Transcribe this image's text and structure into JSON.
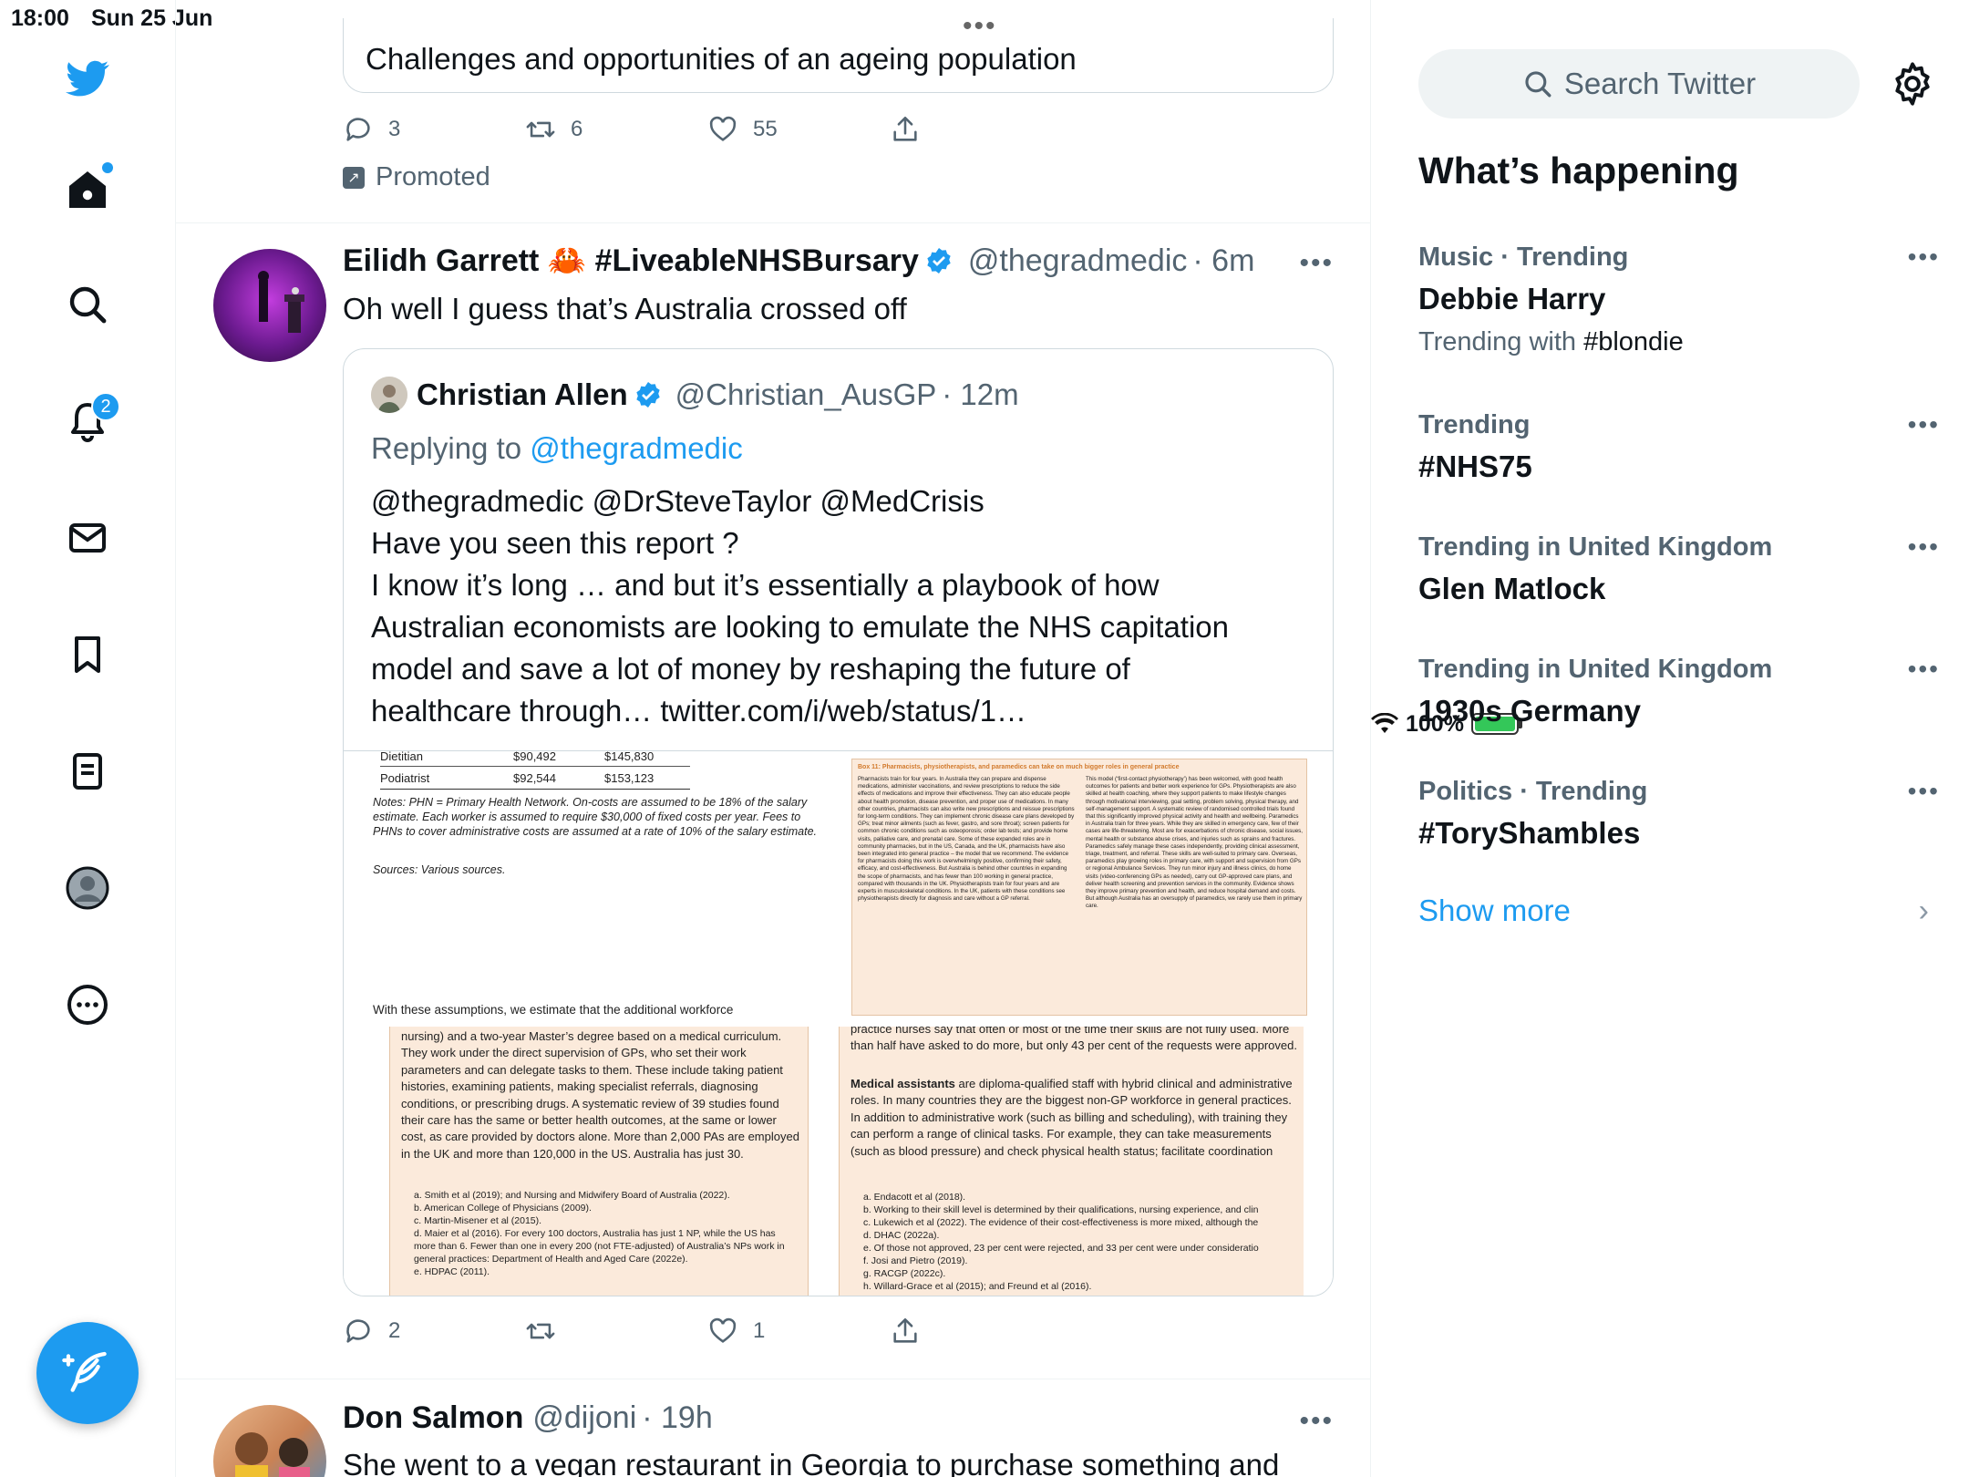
{
  "status_bar": {
    "time": "18:00",
    "date": "Sun 25 Jun",
    "battery": "100%",
    "battery_level": 1.0
  },
  "nav": {
    "notifications_badge": "2",
    "icons": [
      "twitter-logo-icon",
      "home-icon",
      "search-icon",
      "bell-icon",
      "mail-icon",
      "bookmark-icon",
      "lists-icon",
      "profile-icon",
      "more-circle-icon",
      "compose-icon"
    ]
  },
  "promo_tweet": {
    "card_text": "Challenges and opportunities of an ageing population",
    "replies": "3",
    "retweets": "6",
    "likes": "55",
    "promoted_label": "Promoted"
  },
  "tweet1": {
    "author_name": "Eilidh Garrett 🦀 #LiveableNHSBursary",
    "handle": "@thegradmedic",
    "time": "· 6m",
    "text": "Oh well I guess that’s Australia crossed off",
    "replies": "2",
    "retweets": "",
    "likes": "1",
    "quote": {
      "author_name": "Christian Allen",
      "handle": "@Christian_AusGP",
      "time": "· 12m",
      "replying_prefix": "Replying to",
      "replying_to": "@thegradmedic",
      "lines": [
        "@thegradmedic @DrSteveTaylor @MedCrisis",
        "Have you seen this report ?",
        "I know it’s long … and but it’s essentially a playbook of how",
        "Australian economists are looking to emulate the NHS capitation",
        "model and save a lot of money by reshaping the future of",
        "healthcare through… twitter.com/i/web/status/1…"
      ],
      "images": {
        "a": {
          "rows": [
            [
              "Dietitian",
              "$90,492",
              "$145,830"
            ],
            [
              "Podiatrist",
              "$92,544",
              "$153,123"
            ]
          ],
          "notes": "Notes: PHN = Primary Health Network. On-costs are assumed to be 18% of the salary estimate. Each worker is assumed to require $30,000 of fixed costs per year. Fees to PHNs to cover administrative costs are assumed at a rate of 10% of the salary estimate.",
          "sources": "Sources: Various sources.",
          "footer": "With these assumptions, we estimate that the additional workforce"
        },
        "b": {
          "title": "Box 11: Pharmacists, physiotherapists, and paramedics can take on much bigger roles in general practice",
          "col1": "Pharmacists train for four years. In Australia they can prepare and dispense medications, administer vaccinations, and review prescriptions to reduce the side effects of medications and improve their effectiveness. They can also educate people about health promotion, disease prevention, and proper use of medications. In many other countries, pharmacists can also write new prescriptions and reissue prescriptions for long-term conditions. They can implement chronic disease care plans developed by GPs; treat minor ailments (such as fever, gastro, and sore throat); screen patients for common chronic conditions such as osteoporosis; order lab tests; and provide home visits, palliative care, and prenatal care. Some of these expanded roles are in community pharmacies, but in the US, Canada, and the UK, pharmacists have also been integrated into general practice – the model that we recommend. The evidence for pharmacists doing this work is overwhelmingly positive, confirming their safety, efficacy, and cost-effectiveness. But Australia is behind other countries in expanding the scope of pharmacists, and has fewer than 100 working in general practice, compared with thousands in the UK. Physiotherapists train for four years and are experts in musculoskeletal conditions. In the UK, patients with these conditions see physiotherapists directly for diagnosis and care without a GP referral.",
          "col2": "This model (‘first-contact physiotherapy’) has been welcomed, with good health outcomes for patients and better work experience for GPs. Physiotherapists are also skilled at health coaching, where they support patients to make lifestyle changes through motivational interviewing, goal setting, problem solving, physical therapy, and self-management support. A systematic review of randomised controlled trials found that this significantly improved physical activity and health and wellbeing. Paramedics in Australia train for three years. While they are skilled in emergency care, few of their cases are life-threatening. Most are for exacerbations of chronic disease, social issues, mental health or substance abuse crises, and injuries such as sprains and fractures. Paramedics safely manage these cases independently, providing clinical assessment, triage, treatment, and referral. These skills are well-suited to primary care. Overseas, paramedics play growing roles in primary care, with support and supervision from GPs or regional Ambulance Services. They run minor injury and illness clinics, do home visits (video-conferencing GPs as needed), carry out GP-approved care plans, and deliver health screening and prevention services in the community. Evidence shows they improve primary prevention and health, and reduce hospital demand and costs. But although Australia has an oversupply of paramedics, we rarely use them in primary care."
        },
        "c": {
          "text": "nursing) and a two-year Master’s degree based on a medical curriculum. They work under the direct supervision of GPs, who set their work parameters and can delegate tasks to them. These include taking patient histories, examining patients, making specialist referrals, diagnosing conditions, or prescribing drugs. A systematic review of 39 studies found their care has the same or better health outcomes, at the same or lower cost, as care provided by doctors alone. More than 2,000 PAs are employed in the UK and more than 120,000 in the US. Australia has just 30.",
          "refs": [
            "a.  Smith et al (2019);  and Nursing and Midwifery Board of Australia (2022).",
            "b.  American College of Physicians (2009).",
            "c.  Martin-Misener et al (2015).",
            "d.  Maier et al (2016). For every 100 doctors, Australia has just 1 NP, while the US has more than 6. Fewer than one in every 200 (not FTE-adjusted) of Australia’s NPs work in general practices: Department of Health and Aged Care (2022e).",
            "e.  HDPAC (2011)."
          ]
        },
        "d": {
          "text_top": "practice nurses say that often or most of the time their skills are not fully used. More than half have asked to do more, but only 43 per cent of the requests were approved.",
          "bold": "Medical assistants",
          "text_main": " are diploma-qualified staff with hybrid clinical and administrative roles. In many countries they are the biggest non-GP workforce in general practices. In addition to administrative work (such as billing and scheduling), with training they can perform a range of clinical tasks. For example, they can take measurements (such as blood pressure) and check physical health status; facilitate coordination",
          "refs": [
            "a.  Endacott et al (2018).",
            "b.  Working to their skill level is determined by their qualifications, nursing experience, and clin",
            "c.  Lukewich et al (2022). The evidence of their cost-effectiveness is more mixed, although the",
            "d.  DHAC (2022a).",
            "e.  Of those not approved, 23 per cent were rejected, and 33 per cent were under consideratio",
            "f.  Josi and Pietro (2019).",
            "g.  RACGP (2022c).",
            "h.  Willard-Grace et al (2015); and Freund et al (2016)."
          ]
        }
      }
    }
  },
  "tweet2": {
    "author_name": "Don Salmon",
    "handle": "@dijoni",
    "time": "· 19h",
    "text": "She went to a vegan restaurant in Georgia to purchase something and"
  },
  "sidebar": {
    "search_placeholder": "Search Twitter",
    "whats_happening": "What’s happening",
    "trends": [
      {
        "context": "Music · Trending",
        "title": "Debbie Harry",
        "sub_prefix": "Trending with ",
        "sub_tag": "#blondie"
      },
      {
        "context": "Trending",
        "title": "#NHS75",
        "sub_prefix": "",
        "sub_tag": ""
      },
      {
        "context": "Trending in United Kingdom",
        "title": "Glen Matlock",
        "sub_prefix": "",
        "sub_tag": ""
      },
      {
        "context": "Trending in United Kingdom",
        "title": "1930s Germany",
        "sub_prefix": "",
        "sub_tag": ""
      },
      {
        "context": "Politics · Trending",
        "title": "#ToryShambles",
        "sub_prefix": "",
        "sub_tag": ""
      }
    ],
    "show_more": "Show more"
  },
  "colors": {
    "accent": "#1d9bf0",
    "secondary_text": "#536471",
    "border": "#cfd9de",
    "doc_peach": "#fbeadb"
  }
}
